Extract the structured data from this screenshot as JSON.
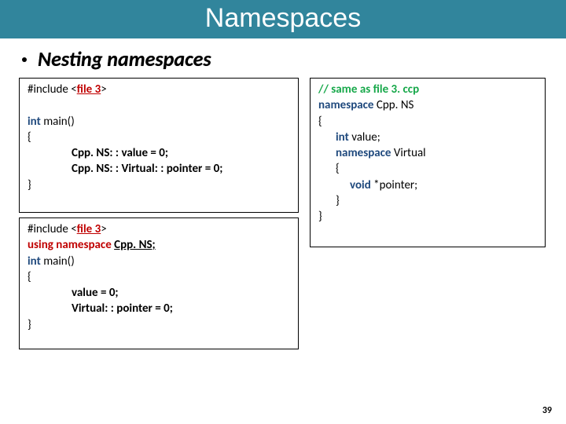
{
  "title": "Namespaces",
  "bullet": "Nesting namespaces",
  "box1": {
    "l1_pre": "#include <",
    "l1_file": "file 3",
    "l1_post": ">",
    "l3a": "int",
    "l3b": " main()",
    "l4": "{",
    "l5": "Cpp. NS: : value = 0;",
    "l6": "Cpp. NS: : Virtual: : pointer = 0;",
    "l7": "}"
  },
  "box2": {
    "l1_pre": "#include <",
    "l1_file": "file 3",
    "l1_post": ">",
    "l2a": "using namespace ",
    "l2b": "Cpp. NS;",
    "l3a": "int",
    "l3b": " main()",
    "l4": "{",
    "l5": "value = 0;",
    "l6": "Virtual: : pointer = 0;",
    "l7": "}"
  },
  "box3": {
    "l1": "// same as file 3. ccp",
    "l2a": "namespace",
    "l2b": " Cpp. NS",
    "l3": "{",
    "l4a": "int ",
    "l4b": "value;",
    "l5a": "namespace ",
    "l5b": "Virtual",
    "l6": "{",
    "l7a": "void ",
    "l7b": "*pointer;",
    "l8": "}",
    "l9": "}"
  },
  "page_num": "39"
}
